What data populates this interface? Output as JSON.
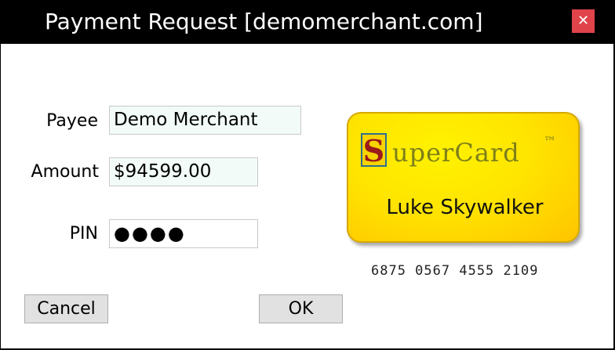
{
  "window": {
    "title": "Payment Request [demomerchant.com]",
    "close_glyph": "✕"
  },
  "form": {
    "payee_label": "Payee",
    "payee_value": "Demo Merchant",
    "amount_label": "Amount",
    "amount_value": "$94599.00",
    "pin_label": "PIN",
    "pin_value": "●●●●"
  },
  "buttons": {
    "cancel": "Cancel",
    "ok": "OK"
  },
  "card": {
    "brand_initial": "S",
    "brand_rest": "uperCard",
    "trademark": "™",
    "holder": "Luke Skywalker",
    "number": "6875 0567 4555 2109"
  }
}
